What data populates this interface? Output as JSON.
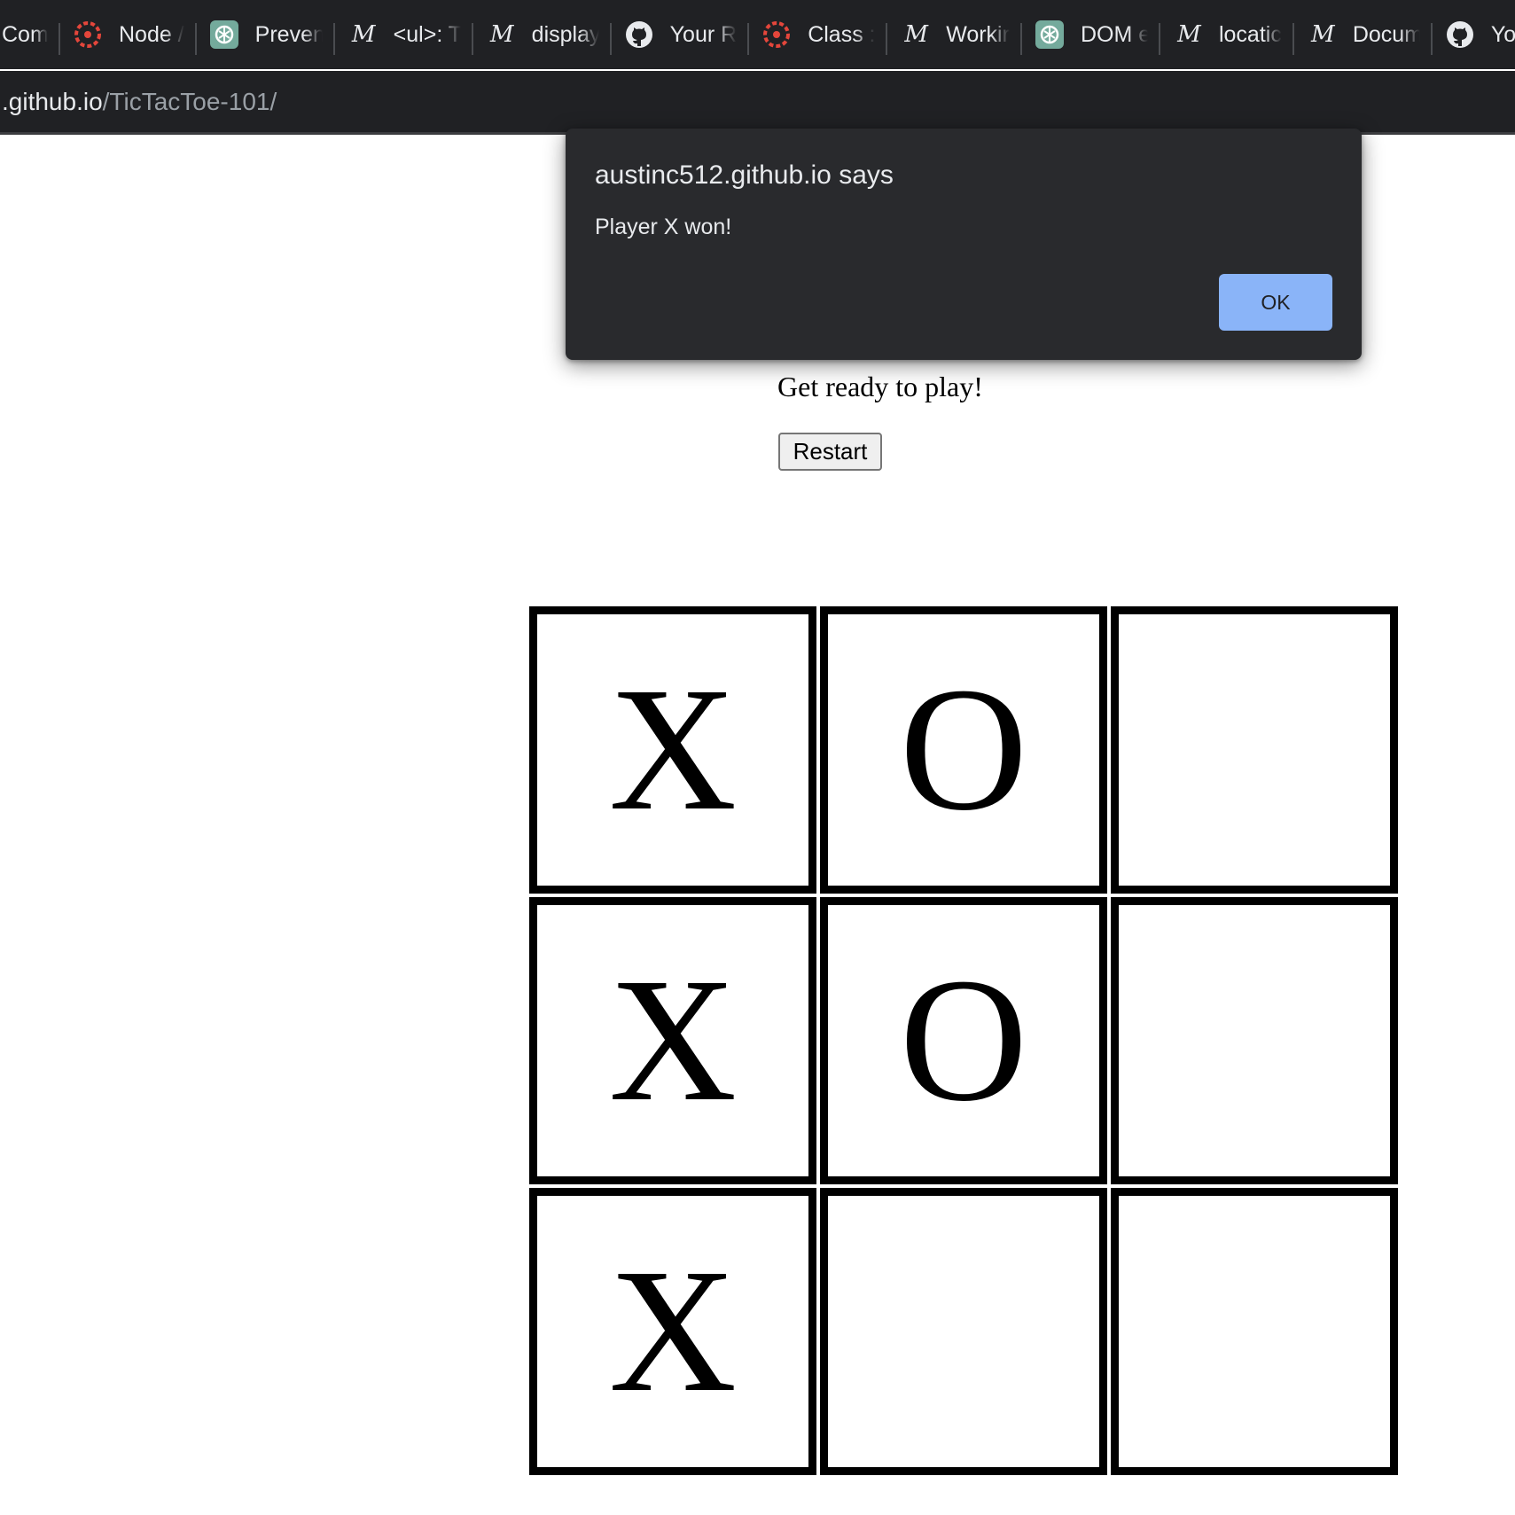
{
  "browser": {
    "bookmarks": [
      {
        "label": "Com",
        "icon": "none"
      },
      {
        "label": "Node /",
        "icon": "canvas-icon"
      },
      {
        "label": "Preven",
        "icon": "chatgpt-icon"
      },
      {
        "label": "<ul>: T",
        "icon": "mdn-icon"
      },
      {
        "label": "display",
        "icon": "mdn-icon"
      },
      {
        "label": "Your R",
        "icon": "github-icon"
      },
      {
        "label": "Class :",
        "icon": "canvas-icon"
      },
      {
        "label": "Workir",
        "icon": "mdn-icon"
      },
      {
        "label": "DOM e",
        "icon": "chatgpt-icon"
      },
      {
        "label": "locatic",
        "icon": "mdn-icon"
      },
      {
        "label": "Docum",
        "icon": "mdn-icon"
      },
      {
        "label": "Your",
        "icon": "github-icon"
      }
    ],
    "address": {
      "host": ".github.io",
      "path": "/TicTacToe-101/"
    }
  },
  "alert": {
    "title": "austinc512.github.io says",
    "message": "Player X won!",
    "ok_label": "OK",
    "accent_color": "#8ab4f8"
  },
  "game": {
    "status": "Get ready to play!",
    "restart_label": "Restart",
    "board": [
      [
        "X",
        "O",
        ""
      ],
      [
        "X",
        "O",
        ""
      ],
      [
        "X",
        "",
        ""
      ]
    ]
  }
}
